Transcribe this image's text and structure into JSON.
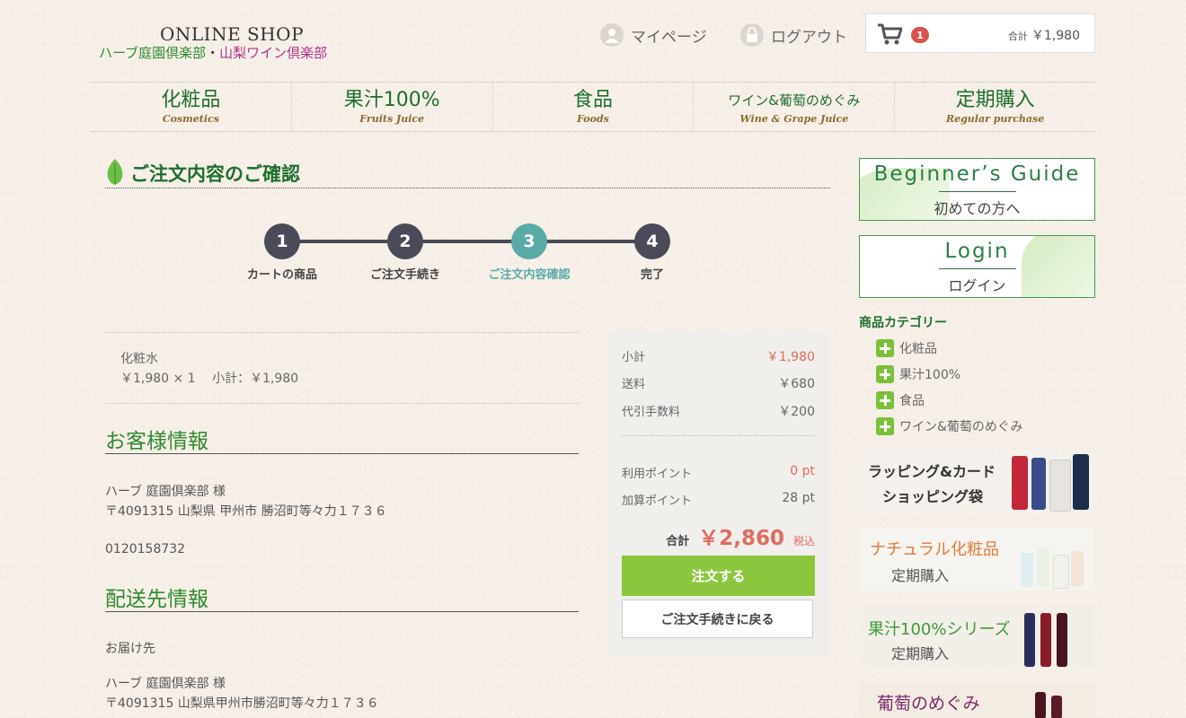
{
  "header": {
    "brand_top": "ONLINE SHOP",
    "brand_herb": "ハーブ庭園倶楽部",
    "brand_dot": "・",
    "brand_wine": "山梨ワイン倶楽部",
    "mypage": "マイページ",
    "logout": "ログアウト",
    "cart_count": "1",
    "cart_total_label": "合計",
    "cart_total_value": "￥1,980"
  },
  "nav": [
    {
      "jp": "化粧品",
      "en": "Cosmetics"
    },
    {
      "jp": "果汁100%",
      "en": "Fruits Juice"
    },
    {
      "jp": "食品",
      "en": "Foods"
    },
    {
      "jp": "ワイン&葡萄のめぐみ",
      "en": "Wine & Grape Juice"
    },
    {
      "jp": "定期購入",
      "en": "Regular purchase"
    }
  ],
  "page_title": "ご注文内容のご確認",
  "steps": [
    {
      "num": "1",
      "label": "カートの商品"
    },
    {
      "num": "2",
      "label": "ご注文手続き"
    },
    {
      "num": "3",
      "label": "ご注文内容確認"
    },
    {
      "num": "4",
      "label": "完了"
    }
  ],
  "item": {
    "name": "化粧水",
    "detail": "￥1,980 × 1　 小計：￥1,980"
  },
  "customer": {
    "title": "お客様情報",
    "name": "ハーブ 庭園倶楽部 様",
    "address": "〒4091315 山梨県 甲州市 勝沼町等々力１７３６",
    "phone": "0120158732"
  },
  "delivery": {
    "title": "配送先情報",
    "label": "お届け先",
    "name": "ハーブ 庭園倶楽部 様",
    "address": "〒4091315 山梨県甲州市勝沼町等々力１７３６"
  },
  "summary": {
    "subtotal_label": "小計",
    "subtotal": "￥1,980",
    "shipping_label": "送料",
    "shipping": "￥680",
    "cod_label": "代引手数料",
    "cod": "￥200",
    "used_points_label": "利用ポイント",
    "used_points": "0 pt",
    "added_points_label": "加算ポイント",
    "added_points": "28 pt",
    "total_label": "合計",
    "total": "￥2,860",
    "tax": "税込",
    "order_button": "注文する",
    "back_button": "ご注文手続きに戻る"
  },
  "sidebar": {
    "guide_en": "Beginner’s Guide",
    "guide_jp": "初めての方へ",
    "login_en": "Login",
    "login_jp": "ログイン",
    "category_title": "商品カテゴリー",
    "categories": [
      "化粧品",
      "果汁100%",
      "食品",
      "ワイン&葡萄のめぐみ"
    ],
    "banner1_line1": "ラッピング&カード",
    "banner1_line2": "ショッピング袋",
    "banner2_line1": "ナチュラル化粧品",
    "banner2_line2": "定期購入",
    "banner3_line1": "果汁100%シリーズ",
    "banner3_line2": "定期購入",
    "banner4_line1": "葡萄のめぐみ"
  },
  "colors": {
    "brand_green": "#1f6e2e",
    "accent_teal": "#5aaaa8",
    "price_red": "#e06b5f",
    "button_green": "#8cc63f"
  }
}
